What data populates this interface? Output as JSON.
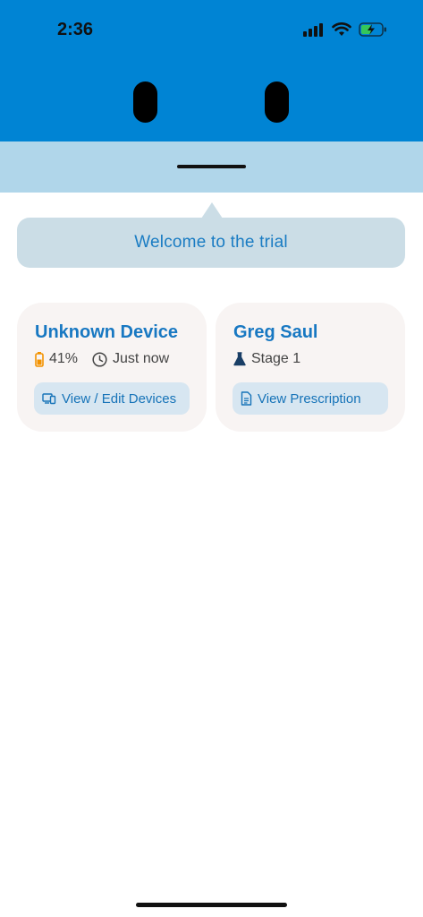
{
  "status_bar": {
    "time": "2:36"
  },
  "tooltip": {
    "text": "Welcome to the trial"
  },
  "device_card": {
    "title": "Unknown Device",
    "battery_text": "41%",
    "battery_level": 0.41,
    "last_seen": "Just now",
    "button_label": "View / Edit Devices"
  },
  "patient_card": {
    "title": "Greg Saul",
    "stage": "Stage 1",
    "button_label": "View Prescription"
  },
  "icons": {
    "signal": "cellular-signal-icon",
    "wifi": "wifi-icon",
    "battery": "battery-charging-icon",
    "device_battery": "battery-icon",
    "clock": "clock-icon",
    "devices": "devices-icon",
    "flask": "flask-icon",
    "document": "document-icon"
  },
  "colors": {
    "header": "#0084d4",
    "drawer": "#b0d6ea",
    "accent": "#1878c2",
    "battery_low": "#f39200",
    "card_bg": "#f8f4f3"
  }
}
